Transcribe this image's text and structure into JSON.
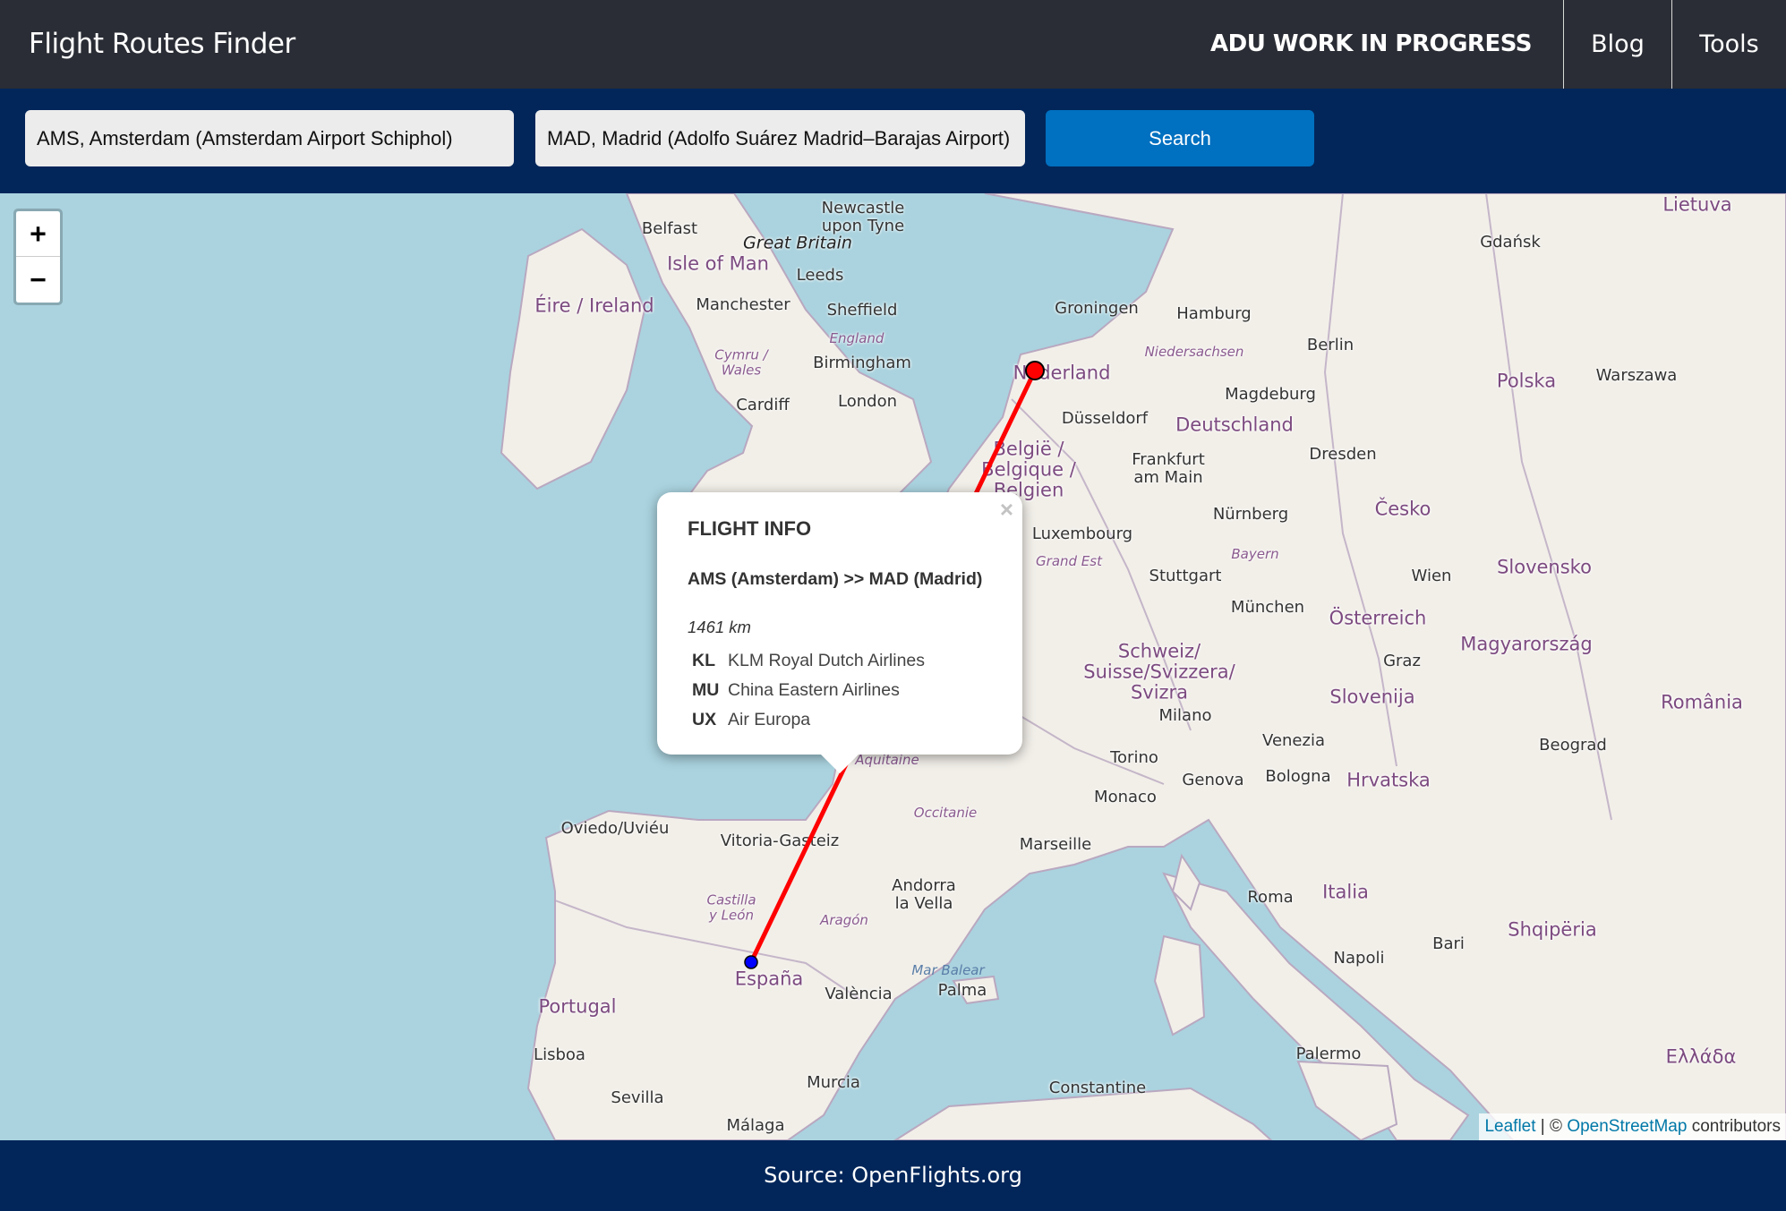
{
  "header": {
    "title": "Flight Routes Finder",
    "nav": {
      "highlight": "ADU WORK IN PROGRESS",
      "blog": "Blog",
      "tools": "Tools"
    }
  },
  "search": {
    "origin_value": "AMS, Amsterdam (Amsterdam Airport Schiphol)",
    "destination_value": "MAD, Madrid (Adolfo Suárez Madrid–Barajas Airport)",
    "button_label": "Search",
    "button_color": "#0070c0"
  },
  "map": {
    "zoom_in": "+",
    "zoom_out": "−",
    "route": {
      "origin": "AMS",
      "destination": "MAD",
      "line_color": "#ff0000",
      "origin_marker_color": "#ff0000",
      "destination_marker_color": "#0000ff"
    },
    "labels": {
      "belfast": "Belfast",
      "newcastle": "Newcastle\nupon Tyne",
      "great_britain": "Great Britain",
      "isle_of_man": "Isle of Man",
      "ireland": "Éire / Ireland",
      "leeds": "Leeds",
      "manchester": "Manchester",
      "sheffield": "Sheffield",
      "england": "England",
      "wales": "Cymru /\nWales",
      "birmingham": "Birmingham",
      "cardiff": "Cardiff",
      "london": "London",
      "groningen": "Groningen",
      "hamburg": "Hamburg",
      "nederland": "Nederland",
      "dusseldorf": "Düsseldorf",
      "deutschland": "Deutschland",
      "berlin": "Berlin",
      "magdeburg": "Magdeburg",
      "belgie": "België /\nBelgique /\nBelgien",
      "frankfurt": "Frankfurt\nam Main",
      "dresden": "Dresden",
      "luxembourg": "Luxembourg",
      "nurnberg": "Nürnberg",
      "stuttgart": "Stuttgart",
      "munchen": "München",
      "cesko": "Česko",
      "osterreich": "Österreich",
      "schweiz": "Schweiz/\nSuisse/Svizzera/\nSvizra",
      "milano": "Milano",
      "torino": "Torino",
      "genova": "Genova",
      "monaco": "Monaco",
      "marseille": "Marseille",
      "venezia": "Venezia",
      "bologna": "Bologna",
      "italia": "Italia",
      "roma": "Roma",
      "napoli": "Napoli",
      "bari": "Bari",
      "palermo": "Palermo",
      "slovenija": "Slovenija",
      "hrvatska": "Hrvatska",
      "polska": "Polska",
      "gdansk": "Gdańsk",
      "warszawa": "Warszawa",
      "espana": "España",
      "portugal": "Portugal",
      "lisboa": "Lisboa",
      "vitoria": "Vitoria-Gasteiz",
      "oviedo": "Oviedo/Uviéu",
      "andorra": "Andorra\nla Vella",
      "valencia": "València",
      "palma": "Palma",
      "sevilla": "Sevilla",
      "murcia": "Murcia",
      "malaga": "Málaga",
      "constantine": "Constantine",
      "occitanie": "Occitanie",
      "aquitaine": "Aquitaine",
      "castilla": "Castilla\ny León",
      "aragon": "Aragón",
      "mar_balear": "Mar Balear",
      "magyarorszag": "Magyarország",
      "slovensko": "Slovensko",
      "wien": "Wien",
      "graz": "Graz",
      "beograd": "Beograd",
      "romania": "România",
      "lietuva": "Lietuva",
      "shqiperia": "Shqipëria",
      "ellada": "Ελλάδα",
      "niedersachsen": "Niedersachsen",
      "bayern": "Bayern",
      "grand_est": "Grand Est"
    },
    "attribution": {
      "leaflet": "Leaflet",
      "separator": " | © ",
      "osm": "OpenStreetMap",
      "contributors": " contributors"
    }
  },
  "popup": {
    "close": "×",
    "title": "FLIGHT INFO",
    "route": "AMS (Amsterdam) >> MAD (Madrid)",
    "distance": "1461 km",
    "airlines": [
      {
        "code": "KL",
        "name": "KLM Royal Dutch Airlines"
      },
      {
        "code": "MU",
        "name": "China Eastern Airlines"
      },
      {
        "code": "UX",
        "name": "Air Europa"
      }
    ]
  },
  "footer": {
    "source": "Source: OpenFlights.org"
  }
}
